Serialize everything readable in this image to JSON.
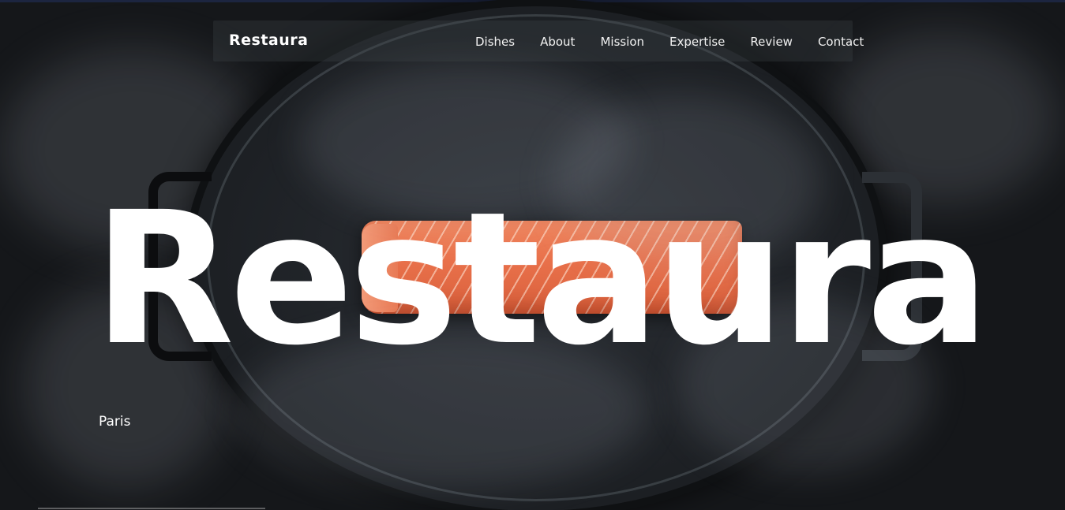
{
  "brand": {
    "logo_text": "Restaura"
  },
  "nav": {
    "items": [
      {
        "label": "Dishes"
      },
      {
        "label": "About"
      },
      {
        "label": "Mission"
      },
      {
        "label": "Expertise"
      },
      {
        "label": "Review"
      },
      {
        "label": "Contact"
      }
    ]
  },
  "hero": {
    "title": "Restaura",
    "location": "Paris",
    "image_subject": "salmon-fillet-in-smoking-pan"
  },
  "colors": {
    "text": "#ffffff",
    "background": "#141618",
    "salmon": "#e8704a"
  }
}
